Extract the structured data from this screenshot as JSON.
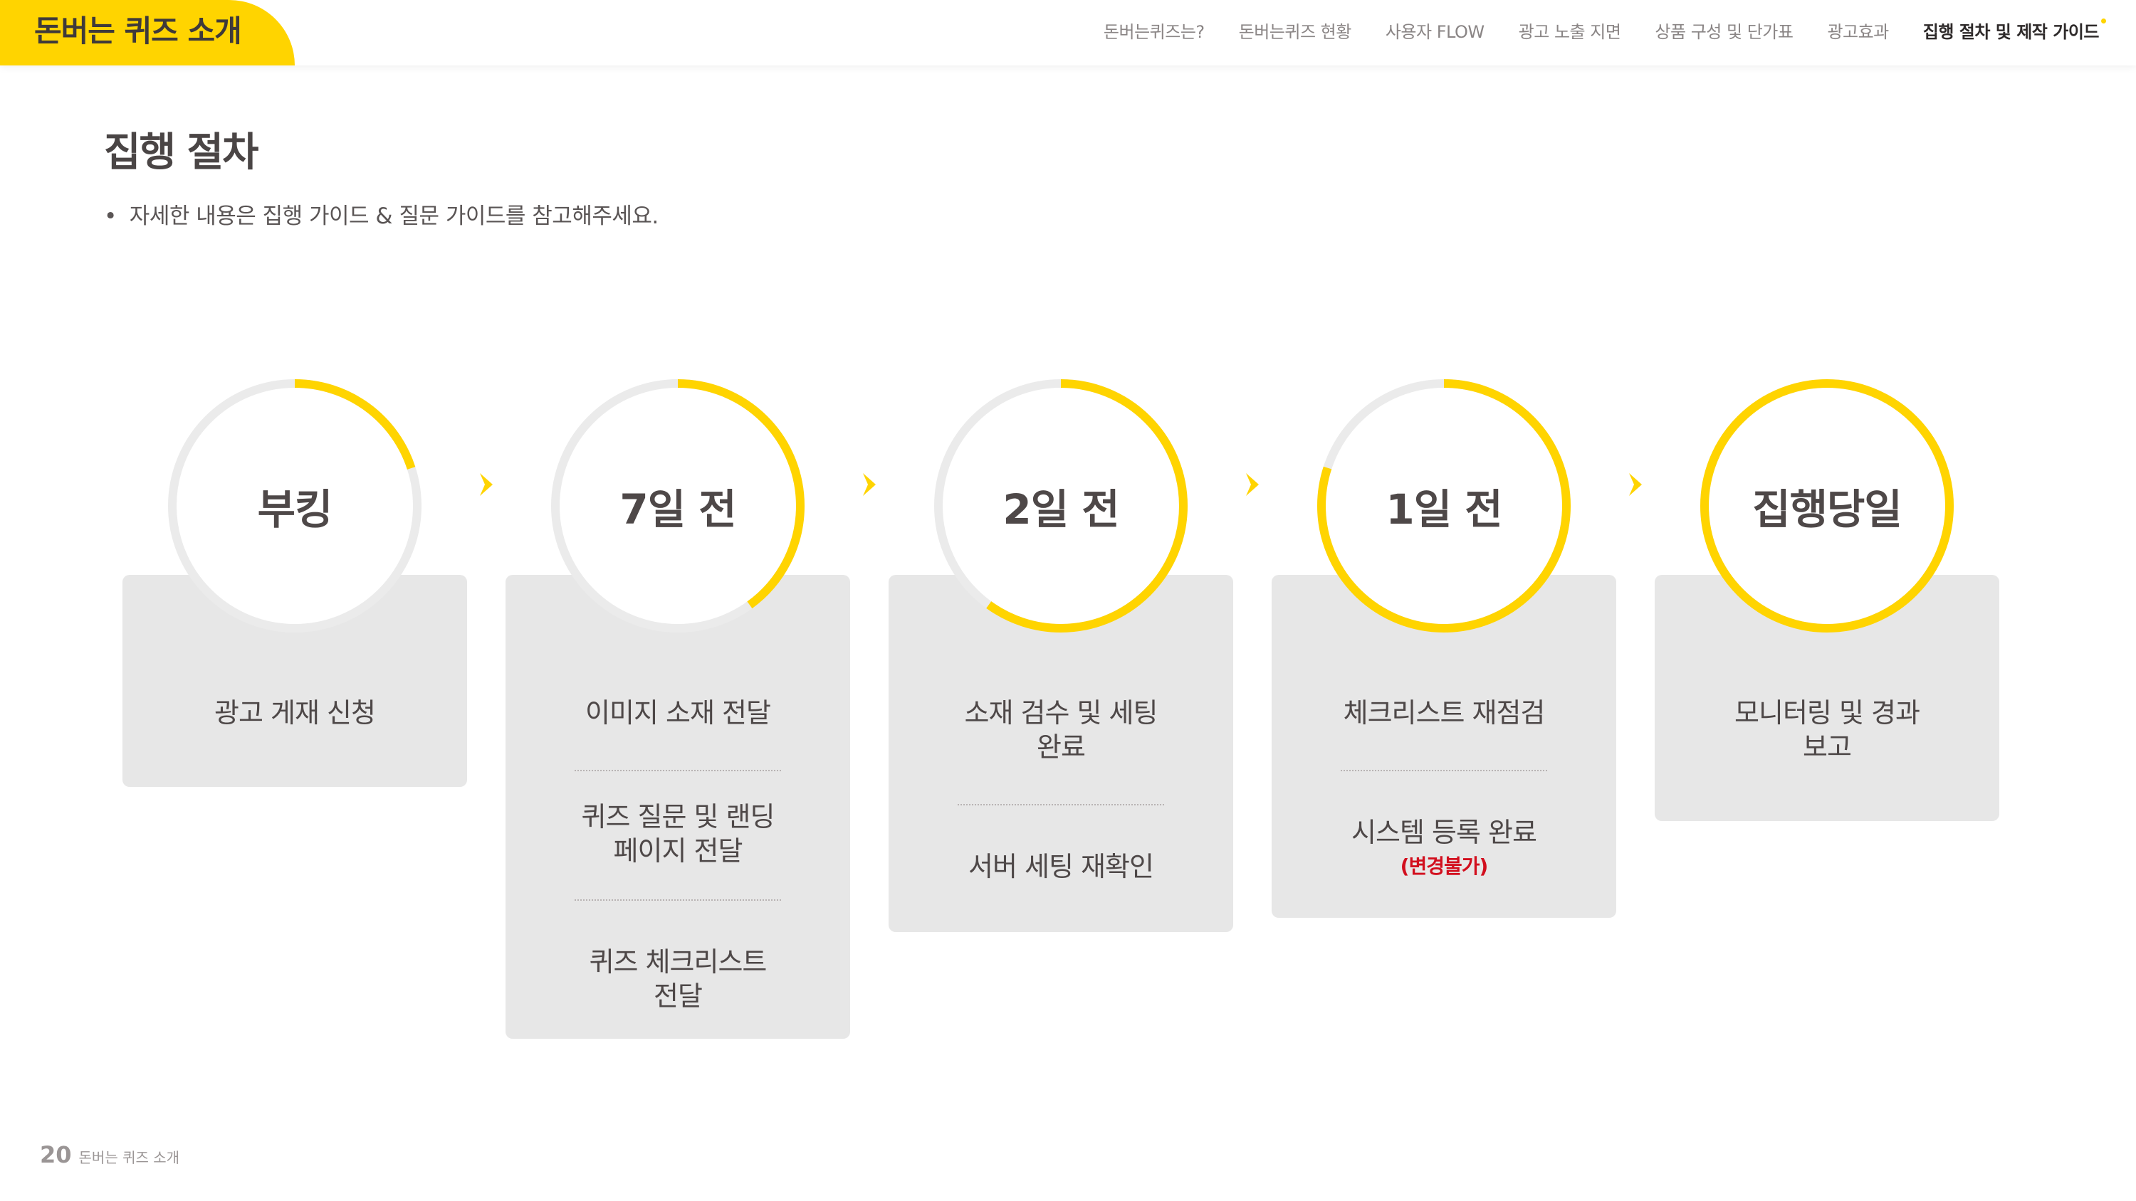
{
  "header": {
    "brand_title": "돈버는 퀴즈 소개",
    "nav": [
      {
        "label": "돈버는퀴즈는?",
        "active": false
      },
      {
        "label": "돈버는퀴즈 현황",
        "active": false
      },
      {
        "label": "사용자 FLOW",
        "active": false
      },
      {
        "label": "광고 노출 지면",
        "active": false
      },
      {
        "label": "상품 구성 및 단가표",
        "active": false
      },
      {
        "label": "광고효과",
        "active": false
      },
      {
        "label": "집행 절차 및 제작 가이드",
        "active": true
      }
    ]
  },
  "page": {
    "title": "집행 절차",
    "note_bullet": "•",
    "note": "자세한 내용은 집행 가이드 & 질문 가이드를 참고해주세요."
  },
  "steps": [
    {
      "label": "부킹",
      "progress": 0.2,
      "tasks": [
        {
          "text": "광고 게재 신청"
        }
      ]
    },
    {
      "label": "7일 전",
      "progress": 0.4,
      "tasks": [
        {
          "text": "이미지 소재 전달"
        },
        {
          "text": "퀴즈 질문 및 랜딩 페이지 전달"
        },
        {
          "text": "퀴즈 체크리스트 전달"
        }
      ]
    },
    {
      "label": "2일 전",
      "progress": 0.6,
      "tasks": [
        {
          "text": "소재 검수 및 세팅 완료"
        },
        {
          "text": "서버 세팅 재확인"
        }
      ]
    },
    {
      "label": "1일 전",
      "progress": 0.8,
      "tasks": [
        {
          "text": "체크리스트 재점검"
        },
        {
          "text": "시스템 등록 완료",
          "sub": "(변경불가)"
        }
      ]
    },
    {
      "label": "집행당일",
      "progress": 1.0,
      "tasks": [
        {
          "text": "모니터링 및 경과 보고"
        }
      ]
    }
  ],
  "footer": {
    "page_number": "20",
    "label": "돈버는 퀴즈 소개"
  },
  "colors": {
    "accent": "#ffd400",
    "ring_track": "#ebebeb",
    "card_bg": "#e7e7e7",
    "warning": "#d20f1e"
  }
}
